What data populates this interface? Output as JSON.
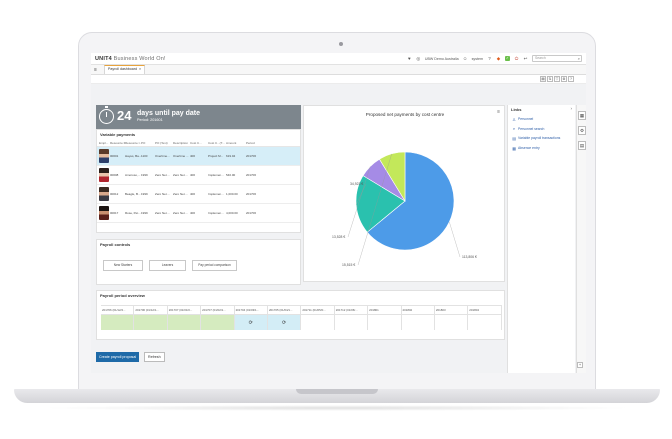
{
  "app": {
    "brand_bold": "UNIT4",
    "brand_rest": "Business World On!",
    "company": "UBW Demo Australia",
    "user": "system",
    "search_placeholder": "Search",
    "tab_label": "Payroll dashboard",
    "tab_close": "×",
    "menu_icon": "≡"
  },
  "countdown": {
    "days": "24",
    "label": "days until pay date",
    "period": "Period: 201601"
  },
  "variable_payments": {
    "title": "Variable payments",
    "headers": [
      "Empl...",
      "Resource ID",
      "Resource I...",
      "PO",
      "PO (Text)",
      "Description",
      "Cost C...",
      "Cost C...(T...",
      "Amount",
      "Period"
    ],
    "rows": [
      [
        "",
        "00001",
        "Hayes, Ba...",
        "1100",
        "Overtime...",
        "Overtime ...",
        "400",
        "Project M...",
        "619.04",
        "201706"
      ],
      [
        "",
        "00008",
        "Amoroso,...",
        "1999",
        "Zero Net ...",
        "Zero Net ...",
        "400",
        "Implemen...",
        "540.00",
        "201706"
      ],
      [
        "",
        "00012",
        "Beagle, B...",
        "1999",
        "Zero Net ...",
        "Zero Net ...",
        "400",
        "Implemen...",
        "1,000.00",
        "201706"
      ],
      [
        "",
        "00017",
        "Rose, Pet...",
        "1999",
        "Zero Net ...",
        "Zero Net ...",
        "400",
        "Implemen...",
        "4,000.00",
        "201706"
      ]
    ]
  },
  "payroll_controls": {
    "title": "Payroll controls",
    "buttons": [
      "New Starters",
      "Leavers",
      "Pay period comparison"
    ]
  },
  "chart_data": {
    "type": "pie",
    "title": "Proposed net payments by cost centre",
    "slices": [
      {
        "label": "113,806 €",
        "value": 113806,
        "color": "#4d9be8"
      },
      {
        "label": "34,923 €",
        "value": 34923,
        "color": "#2ac1ae"
      },
      {
        "label": "13,528 €",
        "value": 13528,
        "color": "#a58be6"
      },
      {
        "label": "15,515 €",
        "value": 15515,
        "color": "#c3e85a"
      }
    ]
  },
  "links": {
    "title": "Links",
    "items": [
      {
        "label": "Personnel",
        "icon": "person-icon"
      },
      {
        "label": "Personnel search",
        "icon": "search-icon"
      },
      {
        "label": "Variable payroll transactions",
        "icon": "list-icon"
      },
      {
        "label": "Absence entry",
        "icon": "calendar-icon"
      }
    ]
  },
  "overview": {
    "title": "Payroll period overview",
    "columns": [
      "201706 (01/12/2...",
      "201706 (01/12/1...",
      "201707 (01/01/0...",
      "201707 (01/02/1...",
      "201704 (01/03/1...",
      "201705 (01/04/1...",
      "201711 (01/05/0...",
      "201712 (01/06/...",
      "201801",
      "201802",
      "201803",
      "201804"
    ],
    "cells": [
      "green",
      "green",
      "green",
      "green",
      "blue",
      "blue",
      "none",
      "none",
      "none",
      "none",
      "none",
      "none"
    ],
    "icon_cells": [
      4,
      5
    ]
  },
  "buttons": {
    "create": "Create payroll proposal",
    "refresh": "Refresh"
  },
  "colors": {
    "countdown_bg": "#7d868d",
    "accent_tab": "#e8a33b",
    "primary_button": "#1e6aa8",
    "period_done": "#d5ebbf",
    "period_current": "#d3edf6"
  }
}
